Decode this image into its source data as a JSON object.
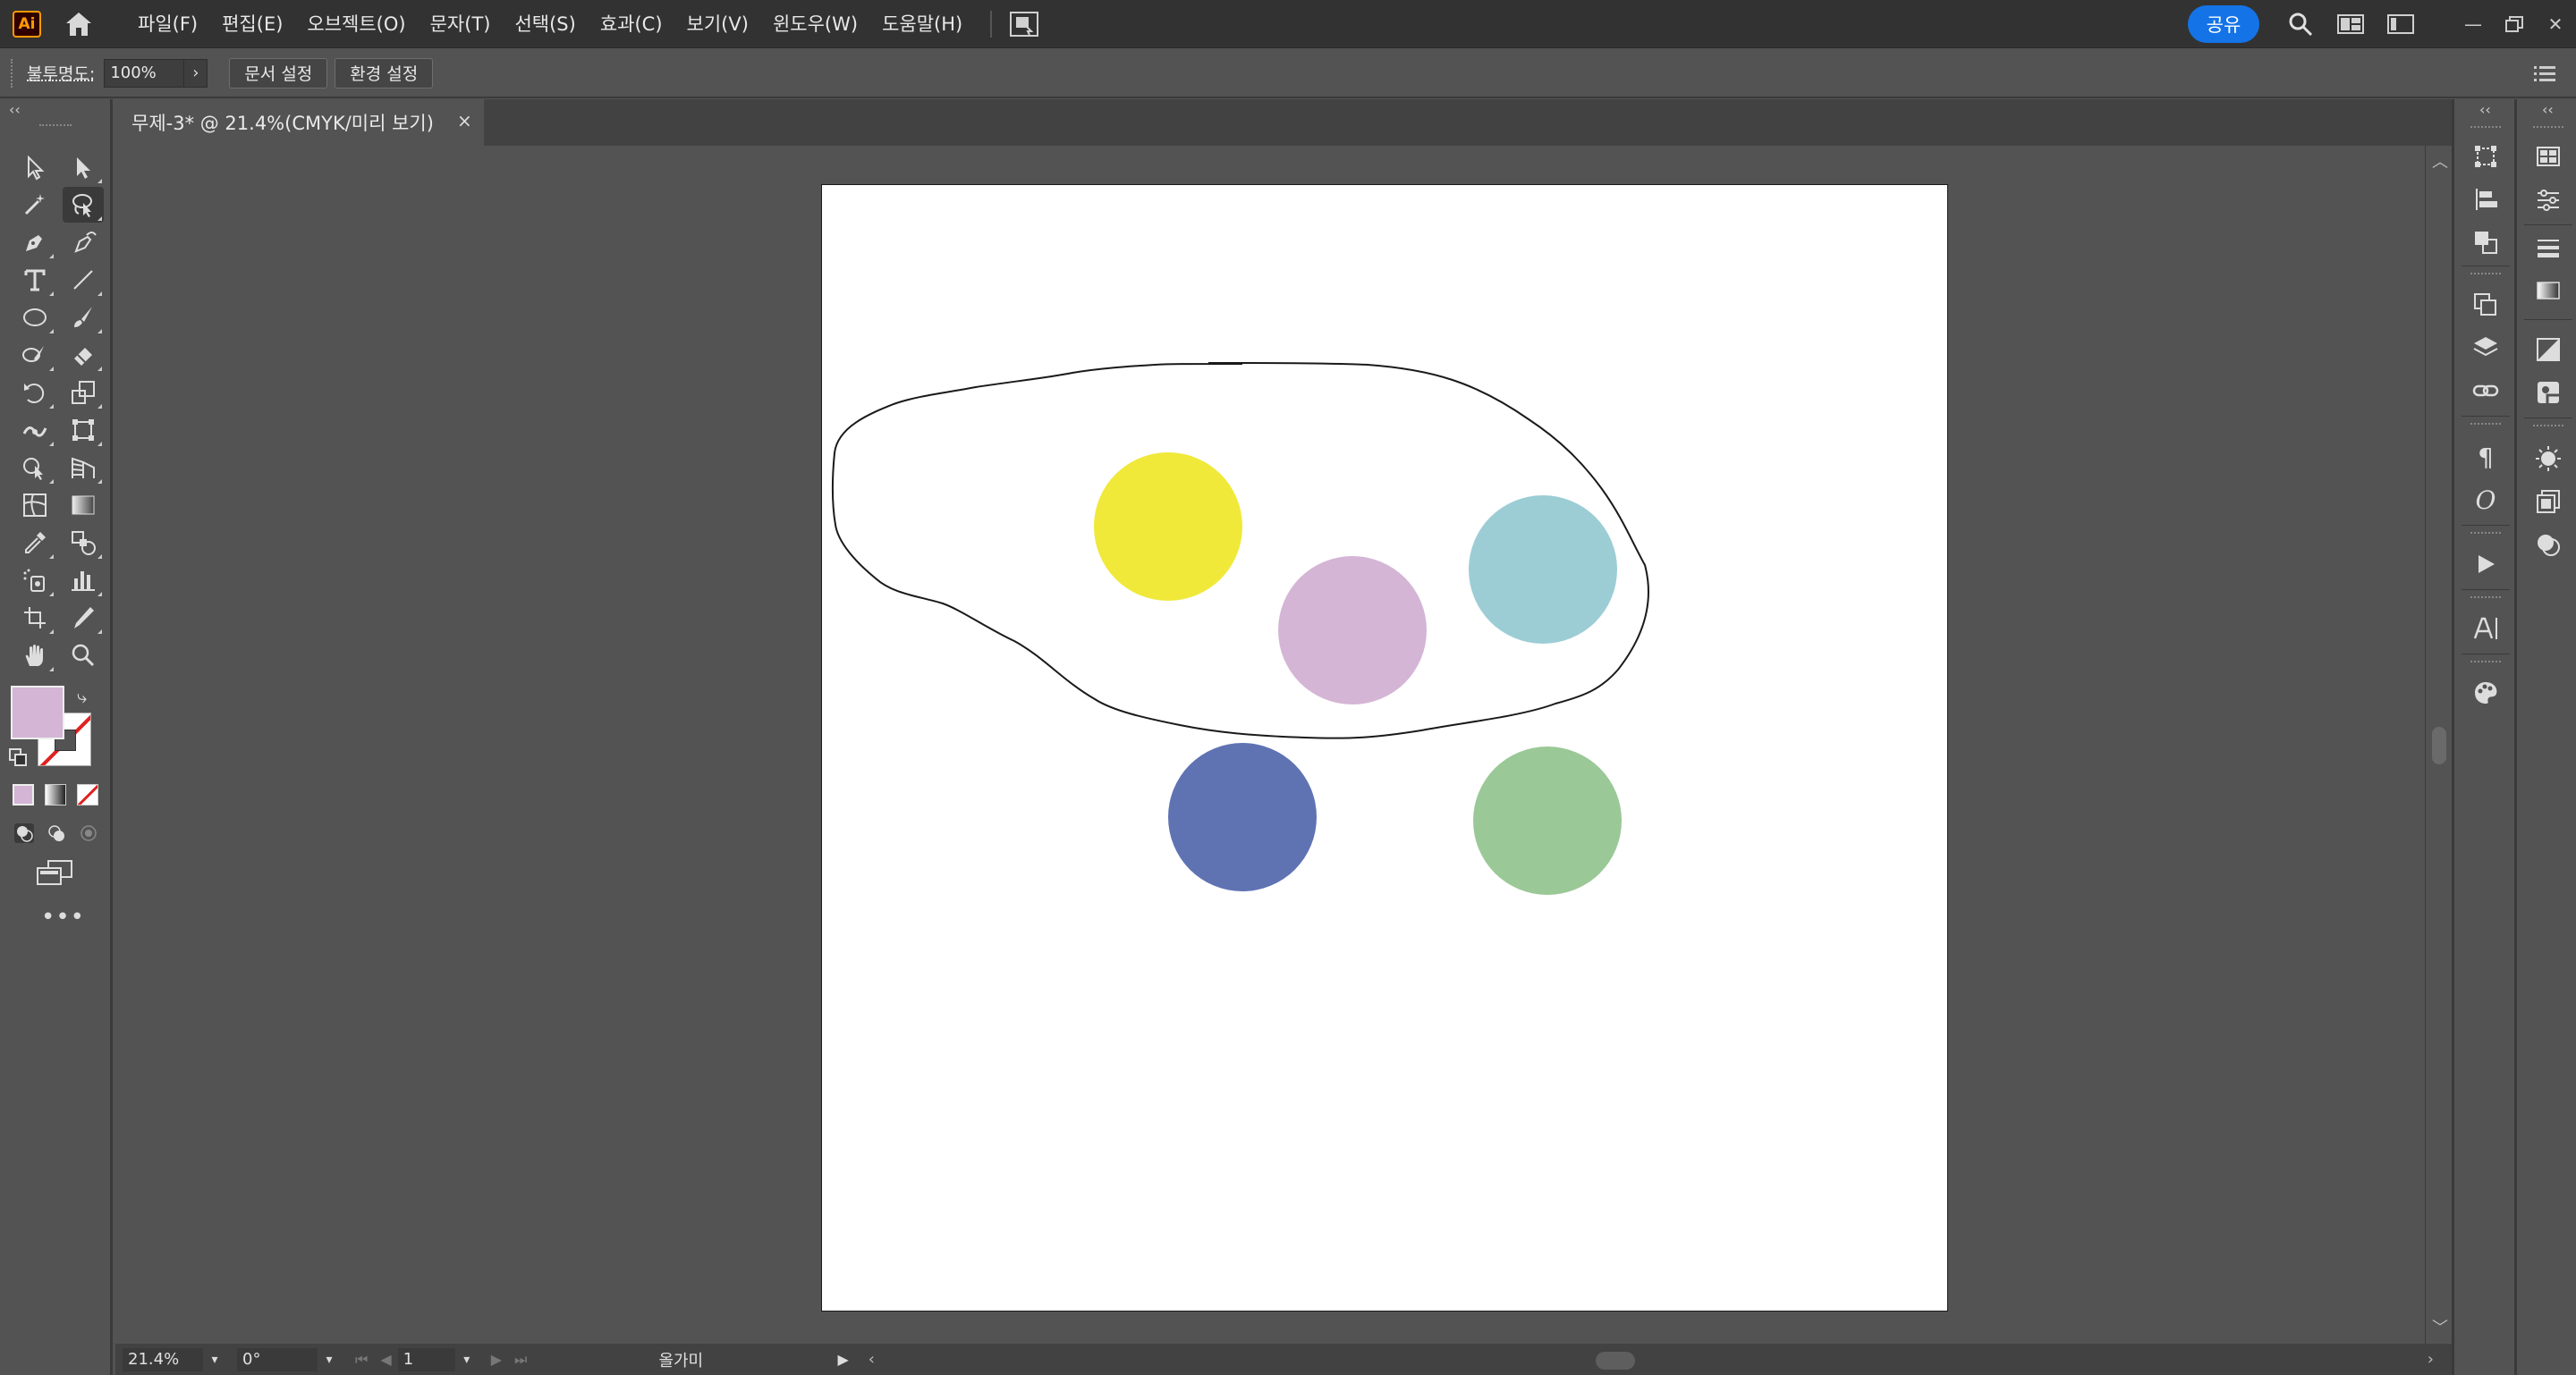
{
  "app": {
    "logo_text": "Ai"
  },
  "menu": {
    "items": [
      "파일(F)",
      "편집(E)",
      "오브젝트(O)",
      "문자(T)",
      "선택(S)",
      "효과(C)",
      "보기(V)",
      "윈도우(W)",
      "도움말(H)"
    ],
    "share_label": "공유"
  },
  "control_bar": {
    "opacity_label": "불투명도:",
    "opacity_value": "100%",
    "doc_setup_label": "문서 설정",
    "preferences_label": "환경 설정"
  },
  "document_tab": {
    "title": "무제-3* @ 21.4%(CMYK/미리 보기)",
    "close_glyph": "×"
  },
  "toolbar": {
    "fill_color": "#d4b5d5",
    "stroke": "none",
    "more_glyph": "•••"
  },
  "artboard": {
    "shapes": [
      {
        "type": "circle",
        "color": "#f0e93a"
      },
      {
        "type": "circle",
        "color": "#d4b5d5"
      },
      {
        "type": "circle",
        "color": "#9ccdd5"
      },
      {
        "type": "circle",
        "color": "#5f73b3"
      },
      {
        "type": "circle",
        "color": "#9bc897"
      },
      {
        "type": "freehand-path",
        "color": "#1a1a1a"
      }
    ]
  },
  "status_bar": {
    "zoom": "21.4%",
    "rotation": "0°",
    "artboard_number": "1",
    "tool_name": "올가미"
  }
}
